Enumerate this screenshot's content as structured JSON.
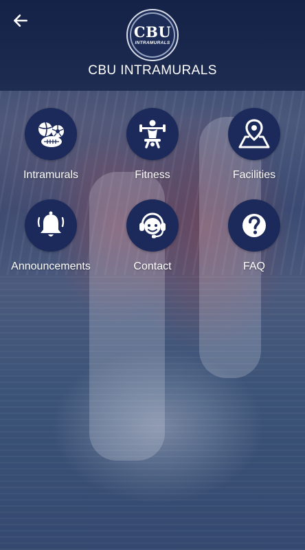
{
  "header": {
    "back_icon": "arrow-left-icon",
    "logo_text": "CBU",
    "logo_subtext": "INTRAMURALS",
    "title": "CBU INTRAMURALS"
  },
  "menu": [
    {
      "label": "Intramurals",
      "icon": "sports-balls-icon"
    },
    {
      "label": "Fitness",
      "icon": "weightlifter-icon"
    },
    {
      "label": "Facilities",
      "icon": "map-pin-icon"
    },
    {
      "label": "Announcements",
      "icon": "bell-icon"
    },
    {
      "label": "Contact",
      "icon": "headset-icon"
    },
    {
      "label": "FAQ",
      "icon": "question-icon"
    }
  ],
  "colors": {
    "header_bg": "#142146",
    "tile_circle": "#1b2a5a",
    "text": "#ffffff"
  }
}
